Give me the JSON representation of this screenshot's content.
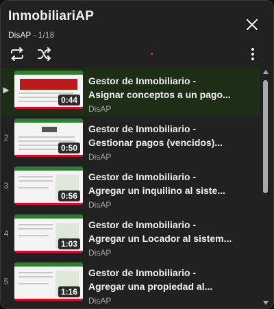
{
  "header": {
    "title": "InmobiliariAP",
    "channel": "DisAP",
    "separator": " - ",
    "position": "1/18"
  },
  "controls": {
    "loop_icon": "loop-icon",
    "shuffle_icon": "shuffle-icon",
    "more_icon": "more-vert-icon",
    "close_icon": "close-icon"
  },
  "items": [
    {
      "index": "▶",
      "title_line1": "Gestor de Inmobiliario -",
      "title_line2": "Asignar conceptos a un pago...",
      "duration": "0:44",
      "channel": "DisAP",
      "active": true
    },
    {
      "index": "2",
      "title_line1": "Gestor de Inmobiliario -",
      "title_line2": "Gestionar pagos (vencidos)...",
      "duration": "0:50",
      "channel": "DisAP"
    },
    {
      "index": "3",
      "title_line1": "Gestor de Inmobiliario -",
      "title_line2": "Agregar un inquilino al siste...",
      "duration": "0:56",
      "channel": "DisAP"
    },
    {
      "index": "4",
      "title_line1": "Gestor de Inmobiliario -",
      "title_line2": "Agregar un Locador al sistem...",
      "duration": "1:03",
      "channel": "DisAP"
    },
    {
      "index": "5",
      "title_line1": "Gestor de Inmobiliario -",
      "title_line2": "Agregar una propiedad al...",
      "duration": "1:16",
      "channel": "DisAP"
    }
  ],
  "colors": {
    "active_bg": "#1e2d15",
    "progress_red": "#e3002b",
    "brand_green": "#2e7d32"
  }
}
